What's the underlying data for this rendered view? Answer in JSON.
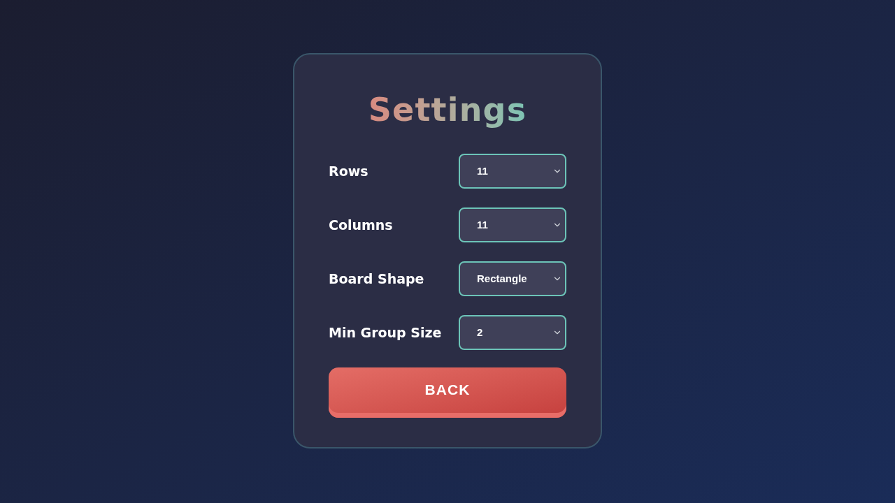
{
  "title": "Settings",
  "settings": [
    {
      "label": "Rows",
      "value": "11"
    },
    {
      "label": "Columns",
      "value": "11"
    },
    {
      "label": "Board Shape",
      "value": "Rectangle"
    },
    {
      "label": "Min Group Size",
      "value": "2"
    }
  ],
  "back_button": "BACK"
}
